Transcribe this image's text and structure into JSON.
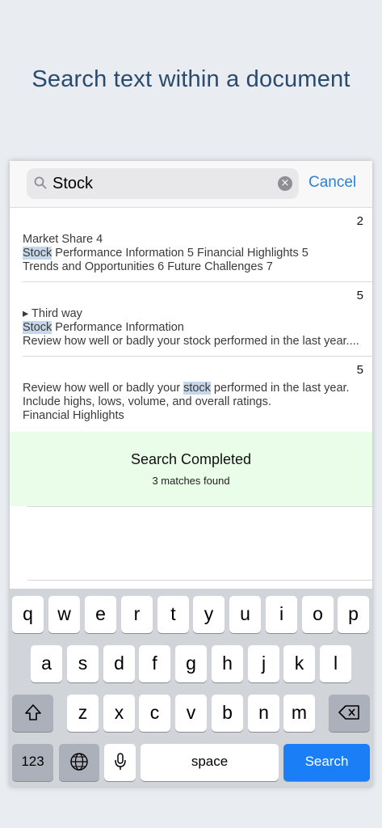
{
  "headline": "Search text within a document",
  "search": {
    "value": "Stock",
    "cancel_label": "Cancel",
    "clear_glyph": "×",
    "search_icon": "magnifier-icon"
  },
  "results": [
    {
      "page": "2",
      "lines": [
        {
          "parts": [
            "Market Share 4"
          ]
        },
        {
          "highlight": "Stock",
          "rest": " Performance Information 5 Financial Highlights 5"
        },
        {
          "parts": [
            "Trends and Opportunities 6 Future Challenges 7"
          ]
        }
      ]
    },
    {
      "page": "5",
      "lines": [
        {
          "parts": [
            "▸ Third way"
          ]
        },
        {
          "highlight": "Stock",
          "rest": " Performance Information"
        },
        {
          "parts": [
            "Review how well or badly your stock performed in the last year...."
          ]
        }
      ]
    },
    {
      "page": "5",
      "lines": [
        {
          "before": "Review how well or badly your ",
          "highlight": "stock",
          "rest": " performed in the last year."
        },
        {
          "parts": [
            "Include highs, lows, volume, and overall ratings."
          ]
        },
        {
          "parts": [
            "Financial Highlights"
          ]
        }
      ]
    }
  ],
  "status": {
    "title": "Search Completed",
    "subtitle": "3 matches found",
    "background": "#e9fde9"
  },
  "keyboard": {
    "row1": [
      "q",
      "w",
      "e",
      "r",
      "t",
      "y",
      "u",
      "i",
      "o",
      "p"
    ],
    "row2": [
      "a",
      "s",
      "d",
      "f",
      "g",
      "h",
      "j",
      "k",
      "l"
    ],
    "row3": [
      "z",
      "x",
      "c",
      "v",
      "b",
      "n",
      "m"
    ],
    "numbers_label": "123",
    "space_label": "space",
    "action_label": "Search",
    "shift_icon": "shift-icon",
    "backspace_icon": "backspace-icon",
    "globe_icon": "globe-icon",
    "mic_icon": "microphone-icon",
    "action_color": "#1a7ef7"
  }
}
